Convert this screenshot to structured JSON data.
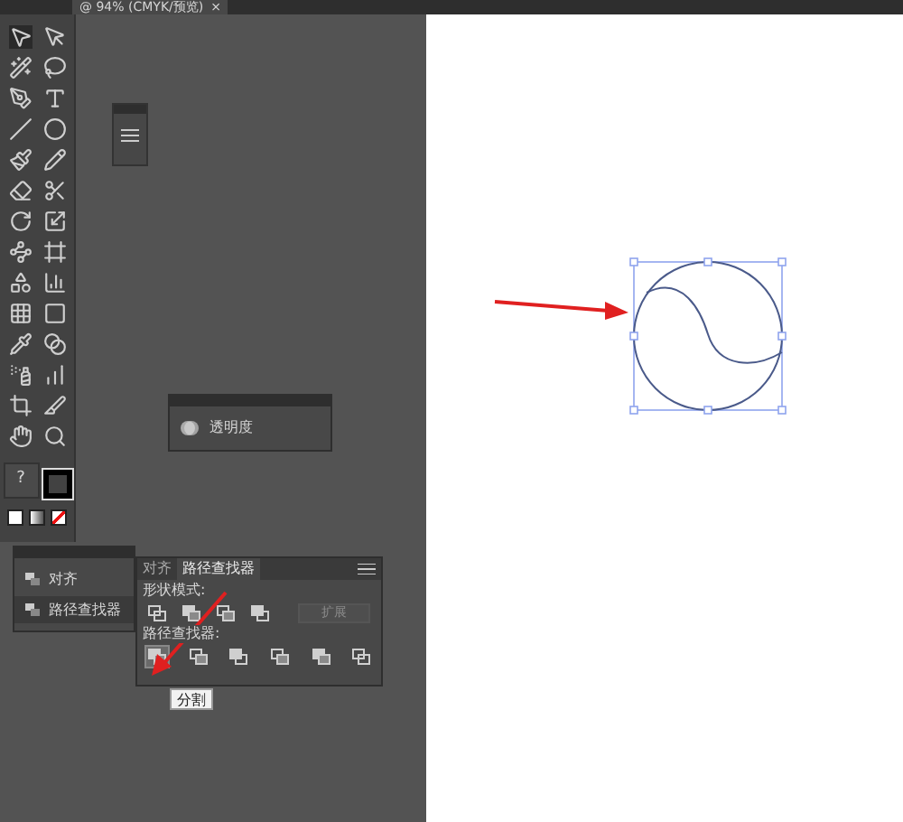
{
  "document_tab": {
    "title": "@ 94% (CMYK/预览)",
    "close": "×"
  },
  "fill_stroke": {
    "fill_label": "?"
  },
  "transparency_panel": {
    "label": "透明度"
  },
  "docked_panel": {
    "items": [
      {
        "label": "对齐",
        "selected": false
      },
      {
        "label": "路径查找器",
        "selected": true
      }
    ]
  },
  "pathfinder_panel": {
    "tabs": [
      {
        "label": "对齐",
        "selected": false
      },
      {
        "label": "路径查找器",
        "selected": true
      }
    ],
    "shape_modes_label": "形状模式:",
    "expand_button": {
      "label": "扩展",
      "disabled": true
    },
    "pathfinders_label": "路径查找器:",
    "pathfinder_buttons": [
      {
        "selected": true
      },
      {
        "selected": false
      },
      {
        "selected": false
      },
      {
        "selected": false
      },
      {
        "selected": false
      },
      {
        "selected": false
      }
    ],
    "tooltip": "分割"
  }
}
